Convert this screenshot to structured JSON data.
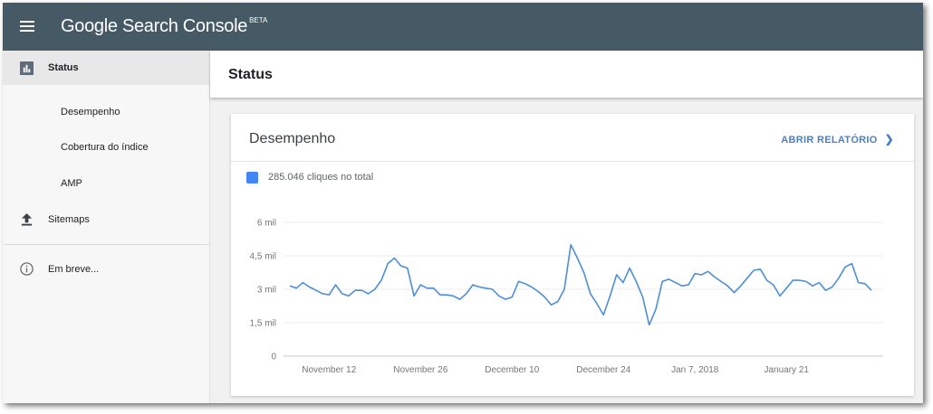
{
  "app": {
    "brand": "Google Search Console",
    "beta": "BETA",
    "menu_icon": "hamburger-menu-icon"
  },
  "sidebar": {
    "items": [
      {
        "label": "Status",
        "icon": "bar-chart-icon",
        "active": true
      },
      {
        "label": "Desempenho",
        "icon": null,
        "active": false
      },
      {
        "label": "Cobertura do índice",
        "icon": null,
        "active": false
      },
      {
        "label": "AMP",
        "icon": null,
        "active": false
      },
      {
        "label": "Sitemaps",
        "icon": "upload-icon",
        "active": false
      },
      {
        "label": "Em breve...",
        "icon": "info-icon",
        "active": false
      }
    ]
  },
  "main": {
    "title": "Status",
    "card": {
      "title": "Desempenho",
      "link_label": "ABRIR RELATÓRIO",
      "link_icon": "chevron-right-icon",
      "legend": "285.046 cliques no total"
    }
  },
  "chart_data": {
    "type": "line",
    "xlabel": "",
    "ylabel": "",
    "ylim": [
      0,
      6000
    ],
    "yticks": [
      0,
      1500,
      3000,
      4500,
      6000
    ],
    "ytick_labels": [
      "0",
      "1,5 mil",
      "3 mil",
      "4,5 mil",
      "6 mil"
    ],
    "xtick_labels": [
      "November 12",
      "November 26",
      "December 10",
      "December 24",
      "Jan 7, 2018",
      "January 21"
    ],
    "xtick_index": [
      6,
      20,
      34,
      48,
      62,
      76
    ],
    "grid": true,
    "color": "#4d8fd6",
    "series": [
      {
        "values": [
          3150,
          3050,
          3300,
          3100,
          2950,
          2800,
          2750,
          3200,
          2800,
          2700,
          2950,
          2950,
          2800,
          3000,
          3400,
          4150,
          4400,
          4050,
          3950,
          2700,
          3200,
          3050,
          3050,
          2750,
          2750,
          2700,
          2550,
          2800,
          3200,
          3100,
          3050,
          3000,
          2700,
          2550,
          2650,
          3350,
          3250,
          3100,
          2900,
          2650,
          2300,
          2450,
          3000,
          5000,
          4400,
          3750,
          2800,
          2350,
          1850,
          2700,
          3650,
          3300,
          3950,
          3350,
          2650,
          1400,
          2100,
          3350,
          3450,
          3300,
          3150,
          3200,
          3700,
          3650,
          3800,
          3550,
          3350,
          3150,
          2850,
          3150,
          3500,
          3850,
          3900,
          3400,
          3200,
          2700,
          3050,
          3400,
          3400,
          3350,
          3150,
          3300,
          2950,
          3100,
          3500,
          4000,
          4150,
          3300,
          3250,
          2950
        ]
      }
    ]
  }
}
